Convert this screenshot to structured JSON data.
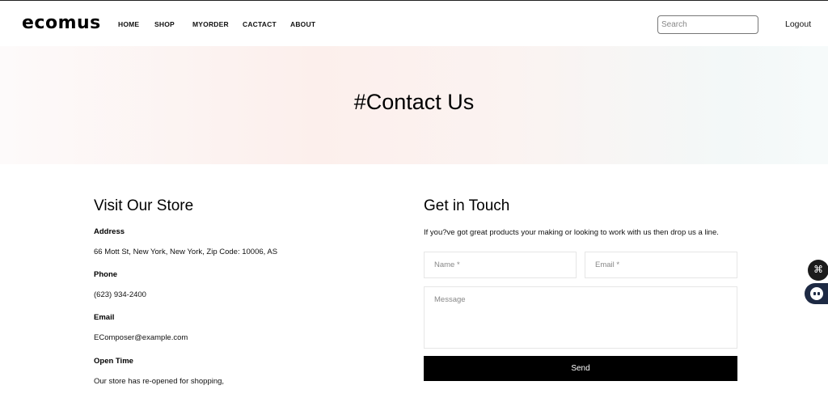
{
  "header": {
    "logo": "ecomus",
    "nav": [
      "HOME",
      "SHOP",
      "MYORDER",
      "CACTACT",
      "ABOUT"
    ],
    "search_placeholder": "Search",
    "logout_label": "Logout"
  },
  "hero": {
    "title": "#Contact Us"
  },
  "store": {
    "heading": "Visit Our Store",
    "address_label": "Address",
    "address": "66 Mott St, New York, New York, Zip Code: 10006, AS",
    "phone_label": "Phone",
    "phone": "(623) 934-2400",
    "email_label": "Email",
    "email": "EComposer@example.com",
    "open_label": "Open Time",
    "open_text": "Our store has re-opened for shopping,"
  },
  "contact": {
    "heading": "Get in Touch",
    "intro": "If you?ve got great products your making or looking to work with us then drop us a line.",
    "name_placeholder": "Name *",
    "email_placeholder": "Email *",
    "message_placeholder": "Message",
    "send_label": "Send"
  },
  "widgets": {
    "apps_icon": "command-icon",
    "chat_icon": "chatbot-icon"
  }
}
